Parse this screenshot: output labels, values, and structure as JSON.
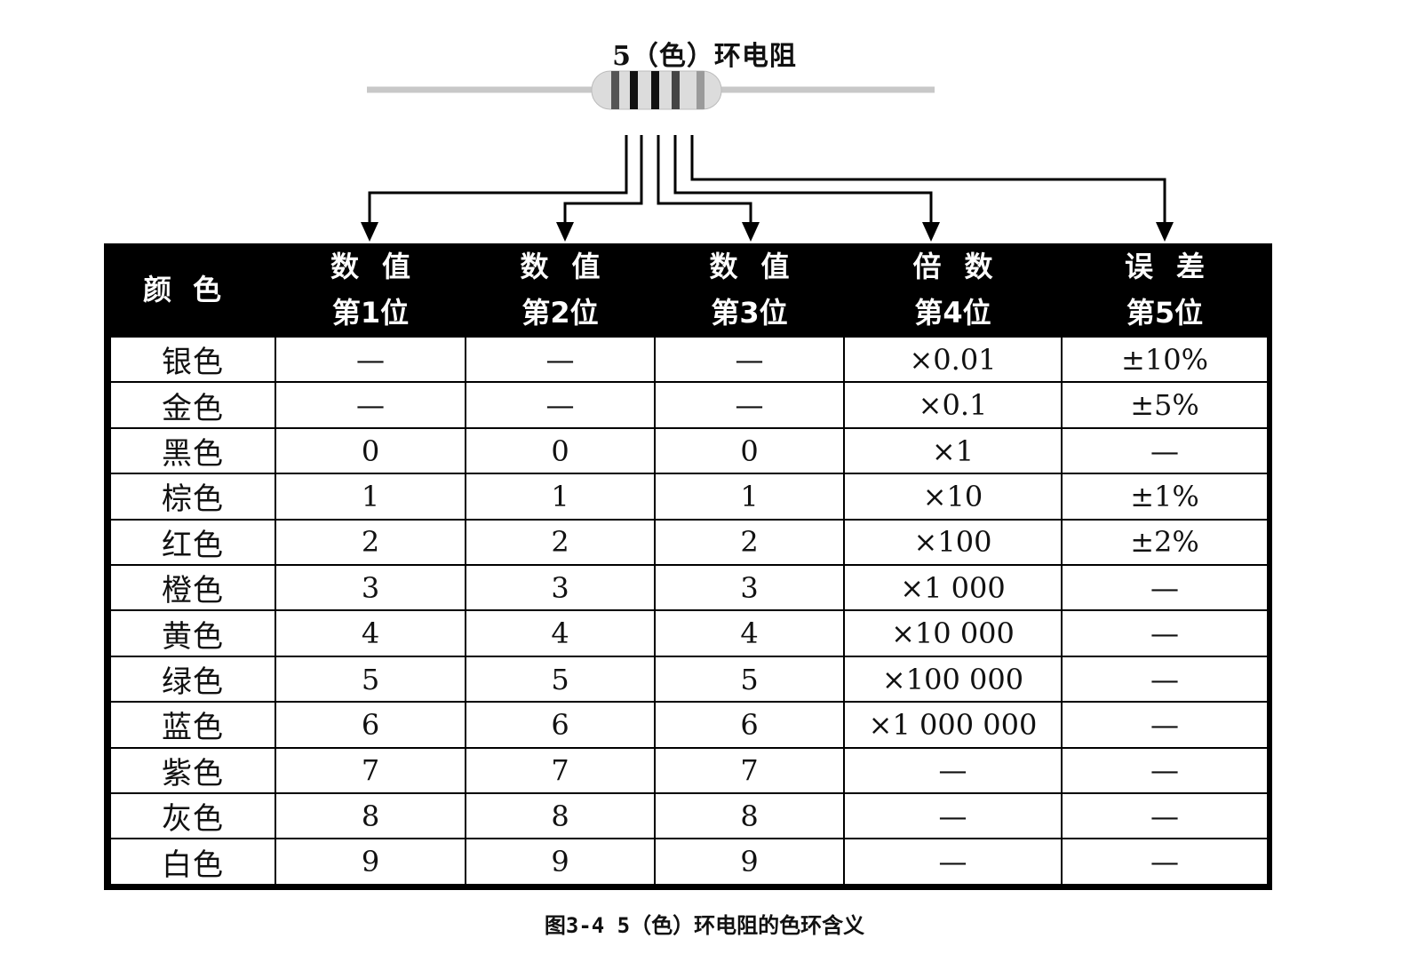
{
  "title": "5（色）环电阻",
  "caption": "图3-4  5（色）环电阻的色环含义",
  "table": {
    "headers": [
      {
        "line1": "颜色",
        "line2": ""
      },
      {
        "line1": "数值",
        "line2": "第1位"
      },
      {
        "line1": "数值",
        "line2": "第2位"
      },
      {
        "line1": "数值",
        "line2": "第3位"
      },
      {
        "line1": "倍数",
        "line2": "第4位"
      },
      {
        "line1": "误差",
        "line2": "第5位"
      }
    ],
    "rows": [
      [
        "银色",
        "—",
        "—",
        "—",
        "×0.01",
        "±10%"
      ],
      [
        "金色",
        "—",
        "—",
        "—",
        "×0.1",
        "±5%"
      ],
      [
        "黑色",
        "0",
        "0",
        "0",
        "×1",
        "—"
      ],
      [
        "棕色",
        "1",
        "1",
        "1",
        "×10",
        "±1%"
      ],
      [
        "红色",
        "2",
        "2",
        "2",
        "×100",
        "±2%"
      ],
      [
        "橙色",
        "3",
        "3",
        "3",
        "×1 000",
        "—"
      ],
      [
        "黄色",
        "4",
        "4",
        "4",
        "×10 000",
        "—"
      ],
      [
        "绿色",
        "5",
        "5",
        "5",
        "×100 000",
        "—"
      ],
      [
        "蓝色",
        "6",
        "6",
        "6",
        "×1 000 000",
        "—"
      ],
      [
        "紫色",
        "7",
        "7",
        "7",
        "—",
        "—"
      ],
      [
        "灰色",
        "8",
        "8",
        "8",
        "—",
        "—"
      ],
      [
        "白色",
        "9",
        "9",
        "9",
        "—",
        "—"
      ]
    ]
  },
  "colors": {
    "lead": "#c8c8c8",
    "body": "#dcdcdc",
    "band_dark": "#111111",
    "band_mid": "#555555",
    "band_light": "#9a9a9a",
    "line": "#000000"
  }
}
